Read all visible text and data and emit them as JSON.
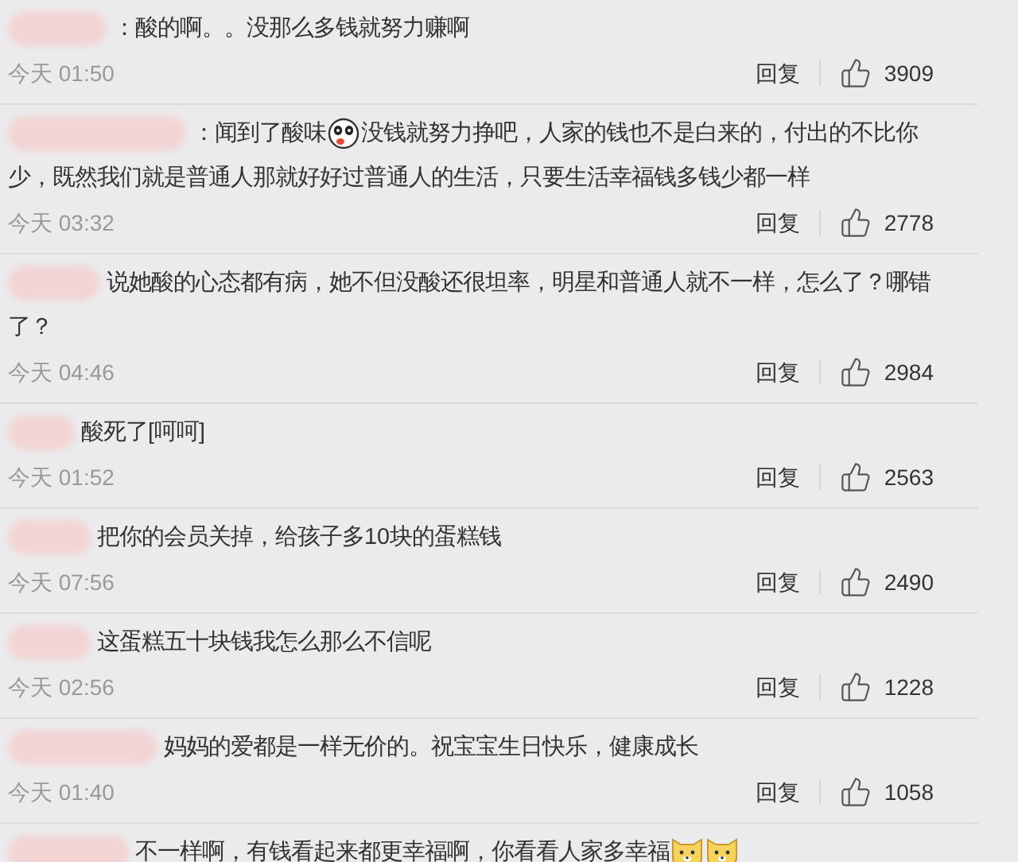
{
  "comments": [
    {
      "lines": [
        [
          {
            "kind": "text",
            "text": "：酸的啊。。没那么多钱就努力赚啊"
          }
        ]
      ],
      "time": "今天 01:50",
      "reply": "回复",
      "likes": "3909"
    },
    {
      "lines": [
        [
          {
            "kind": "text",
            "text": "：闻到了酸味"
          },
          {
            "kind": "panda-emoji"
          },
          {
            "kind": "text",
            "text": "没钱就努力挣吧，人家的钱也不是白来的，付出的不比你"
          }
        ],
        [
          {
            "kind": "text",
            "text": "少，既然我们就是普通人那就好好过普通人的生活，只要生活幸福钱多钱少都一样"
          }
        ]
      ],
      "time": "今天 03:32",
      "reply": "回复",
      "likes": "2778"
    },
    {
      "lines": [
        [
          {
            "kind": "text",
            "text": "说她酸的心态都有病，她不但没酸还很坦率，明星和普通人就不一样，怎么了？哪错"
          }
        ],
        [
          {
            "kind": "text",
            "text": "了？"
          }
        ]
      ],
      "time": "今天 04:46",
      "reply": "回复",
      "likes": "2984"
    },
    {
      "lines": [
        [
          {
            "kind": "text",
            "text": "酸死了[呵呵]"
          }
        ]
      ],
      "time": "今天 01:52",
      "reply": "回复",
      "likes": "2563"
    },
    {
      "lines": [
        [
          {
            "kind": "text",
            "text": "把你的会员关掉，给孩子多10块的蛋糕钱"
          }
        ]
      ],
      "time": "今天 07:56",
      "reply": "回复",
      "likes": "2490"
    },
    {
      "lines": [
        [
          {
            "kind": "text",
            "text": "这蛋糕五十块钱我怎么那么不信呢"
          }
        ]
      ],
      "time": "今天 02:56",
      "reply": "回复",
      "likes": "1228"
    },
    {
      "lines": [
        [
          {
            "kind": "text",
            "text": "妈妈的爱都是一样无价的。祝宝宝生日快乐，健康成长"
          }
        ]
      ],
      "time": "今天 01:40",
      "reply": "回复",
      "likes": "1058"
    },
    {
      "lines": [
        [
          {
            "kind": "text",
            "text": "不一样啊，有钱看起来都更幸福啊，你看看人家多幸福"
          },
          {
            "kind": "dog-emoji"
          },
          {
            "kind": "dog-emoji"
          }
        ]
      ]
    }
  ]
}
